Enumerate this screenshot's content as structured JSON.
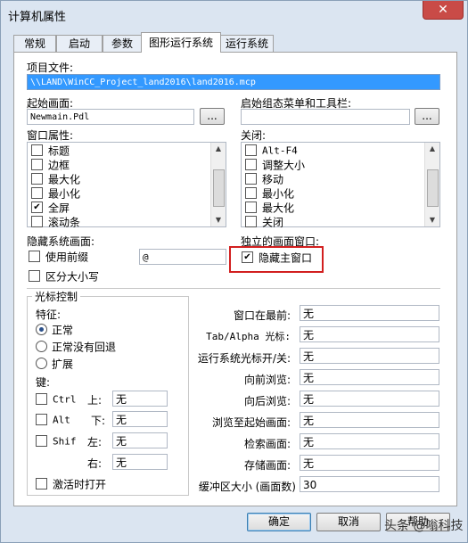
{
  "window": {
    "title": "计算机属性",
    "close_glyph": "✕"
  },
  "tabs": [
    "常规",
    "启动",
    "参数",
    "图形运行系统",
    "运行系统"
  ],
  "project_file": {
    "label": "项目文件:",
    "value": "\\\\LAND\\WinCC_Project_land2016\\land2016.mcp"
  },
  "start_screen": {
    "label": "起始画面:",
    "value": "Newmain.Pdl",
    "browse": "..."
  },
  "start_menu": {
    "label": "启始组态菜单和工具栏:",
    "value": "",
    "browse": "..."
  },
  "window_attrs": {
    "label": "窗口属性:",
    "items": [
      {
        "text": "标题",
        "checked": false
      },
      {
        "text": "边框",
        "checked": false
      },
      {
        "text": "最大化",
        "checked": false
      },
      {
        "text": "最小化",
        "checked": false
      },
      {
        "text": "全屏",
        "checked": true
      },
      {
        "text": "滚动条",
        "checked": false
      }
    ]
  },
  "close_opts": {
    "label": "关闭:",
    "items": [
      {
        "text": "Alt-F4",
        "checked": false
      },
      {
        "text": "调整大小",
        "checked": false
      },
      {
        "text": "移动",
        "checked": false
      },
      {
        "text": "最小化",
        "checked": false
      },
      {
        "text": "最大化",
        "checked": false
      },
      {
        "text": "关闭",
        "checked": false
      }
    ]
  },
  "hidden_screens": {
    "label": "隐藏系统画面:",
    "use_prefix": "使用前缀",
    "prefix_value": "@",
    "case_sensitive": "区分大小写"
  },
  "independent": {
    "label": "独立的画面窗口:",
    "hide_main": "隐藏主窗口",
    "hide_main_checked": true
  },
  "cursor": {
    "group_label": "光标控制",
    "feature_label": "特征:",
    "modes": [
      {
        "text": "正常",
        "selected": true
      },
      {
        "text": "正常没有回退",
        "selected": false
      },
      {
        "text": "扩展",
        "selected": false
      }
    ],
    "keys_label": "键:",
    "keys": [
      {
        "mod": "Ctrl",
        "dir": "上:",
        "value": "无"
      },
      {
        "mod": "Alt",
        "dir": "下:",
        "value": "无"
      },
      {
        "mod": "Shif",
        "dir": "左:",
        "value": "无"
      },
      {
        "mod": "",
        "dir": "右:",
        "value": "无"
      }
    ],
    "activate_on_open": "激活时打开"
  },
  "hotkeys": [
    {
      "label": "窗口在最前:",
      "value": "无"
    },
    {
      "label": "Tab/Alpha 光标:",
      "value": "无"
    },
    {
      "label": "运行系统光标开/关:",
      "value": "无"
    },
    {
      "label": "向前浏览:",
      "value": "无"
    },
    {
      "label": "向后浏览:",
      "value": "无"
    },
    {
      "label": "浏览至起始画面:",
      "value": "无"
    },
    {
      "label": "检索画面:",
      "value": "无"
    },
    {
      "label": "存储画面:",
      "value": "无"
    },
    {
      "label": "缓冲区大小 (画面数)",
      "value": "30"
    }
  ],
  "footer": {
    "ok": "确定",
    "cancel": "取消",
    "help": "帮助"
  },
  "watermark": "头条 @嗡科技"
}
